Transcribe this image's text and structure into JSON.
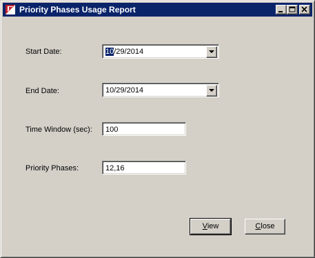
{
  "window": {
    "title": "Priority Phases Usage Report",
    "icon": "report-app-icon",
    "controls": [
      "minimize-icon",
      "maximize-icon",
      "close-icon"
    ]
  },
  "form": {
    "start_date": {
      "label": "Start Date:",
      "selected_part": "10",
      "rest": "/29/2014"
    },
    "end_date": {
      "label": "End Date:",
      "value": "10/29/2014"
    },
    "time_window": {
      "label": "Time Window (sec):",
      "value": "100"
    },
    "priority_phases": {
      "label": "Priority Phases:",
      "value": "12,16"
    }
  },
  "buttons": {
    "view": {
      "mnemonic": "V",
      "rest": "iew"
    },
    "close": {
      "mnemonic": "C",
      "rest": "lose"
    }
  },
  "colors": {
    "face": "#d4d0c8",
    "title_bar": "#0a246a",
    "selection": "#0a246a"
  }
}
